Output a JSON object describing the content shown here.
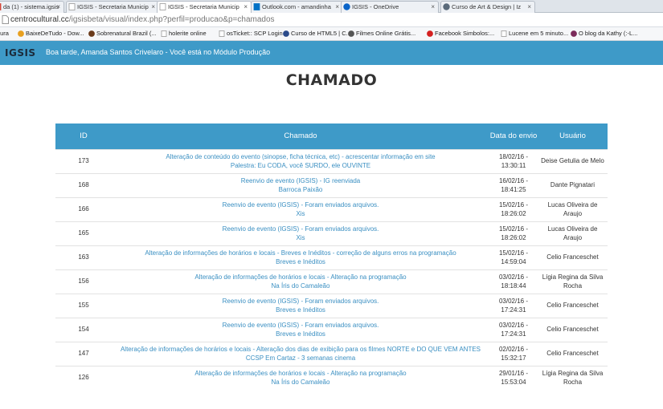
{
  "browser": {
    "tabs": [
      {
        "label": "da (1) - sistema.igsis",
        "icon": "mail-icon",
        "color": "#d44638"
      },
      {
        "label": "IGSIS - Secretaria Municip",
        "icon": "page-icon",
        "color": "#999999"
      },
      {
        "label": "IGSIS - Secretaria Municip",
        "icon": "page-icon",
        "color": "#999999",
        "active": true
      },
      {
        "label": "Outlook.com - amandinha",
        "icon": "outlook-icon",
        "color": "#0072c6"
      },
      {
        "label": "IGSIS - OneDrive",
        "icon": "onedrive-icon",
        "color": "#0a64c8"
      },
      {
        "label": "Curso de Art & Design | Iz",
        "icon": "globe-icon",
        "color": "#5a6a7a"
      }
    ],
    "url_host": "centrocultural.cc",
    "url_path": "/igsisbeta/visual/index.php?perfil=producao&p=chamados",
    "bookmarks": [
      {
        "label": "tura",
        "icon": "",
        "color": ""
      },
      {
        "label": "BaixeDeTudo - Dow...",
        "icon": "bookmark-icon",
        "color": "#e8a020"
      },
      {
        "label": "Sobrenatural Brazil (...",
        "icon": "bookmark-icon",
        "color": "#6a3a1a"
      },
      {
        "label": "holerite online",
        "icon": "page-icon",
        "color": "#999999"
      },
      {
        "label": "osTicket:: SCP Login",
        "icon": "page-icon",
        "color": "#999999"
      },
      {
        "label": "Curso de HTML5 | C...",
        "icon": "bookmark-icon",
        "color": "#2a4a8a"
      },
      {
        "label": "Filmes Online Grátis...",
        "icon": "bookmark-icon",
        "color": "#555555"
      },
      {
        "label": "Facebook Simbolos:...",
        "icon": "bookmark-icon",
        "color": "#d42020"
      },
      {
        "label": "Lucene em 5 minuto...",
        "icon": "page-icon",
        "color": "#999999"
      },
      {
        "label": "O blog da Kathy (:-L...",
        "icon": "bookmark-icon",
        "color": "#7a2a5a"
      }
    ]
  },
  "header": {
    "logo": "IGSIS",
    "greeting": "Boa tarde, Amanda Santos Crivelaro - Você está no Módulo Produção"
  },
  "page_title": "CHAMADO",
  "table": {
    "columns": [
      "ID",
      "Chamado",
      "Data do envio",
      "Usuário"
    ],
    "rows": [
      {
        "id": "173",
        "title": "Alteração de conteúdo do evento (sinopse, ficha técnica, etc) - acrescentar informação em site",
        "event": "Palestra: Eu CODA, você SURDO, ele OUVINTE",
        "date": "18/02/16 - 13:30:11",
        "user": "Deise Getulia de Melo"
      },
      {
        "id": "168",
        "title": "Reenvio de evento (IGSIS) - IG reenviada",
        "event": "Barroca Paixão",
        "date": "16/02/16 - 18:41:25",
        "user": "Dante Pignatari"
      },
      {
        "id": "166",
        "title": "Reenvio de evento (IGSIS) - Foram enviados arquivos.",
        "event": "Xis",
        "date": "15/02/16 - 18:26:02",
        "user": "Lucas Oliveira de Araujo"
      },
      {
        "id": "165",
        "title": "Reenvio de evento (IGSIS) - Foram enviados arquivos.",
        "event": "Xis",
        "date": "15/02/16 - 18:26:02",
        "user": "Lucas Oliveira de Araujo"
      },
      {
        "id": "163",
        "title": "Alteração de informações de horários e locais - Breves e Inéditos - correção de alguns erros na programação",
        "event": "Breves e Inéditos",
        "date": "15/02/16 - 14:59:04",
        "user": "Celio Franceschet"
      },
      {
        "id": "156",
        "title": "Alteração de informações de horários e locais - Alteração na programação",
        "event": "Na Íris do Camaleão",
        "date": "03/02/16 - 18:18:44",
        "user": "Lígia Regina da Silva Rocha"
      },
      {
        "id": "155",
        "title": "Reenvio de evento (IGSIS) - Foram enviados arquivos.",
        "event": "Breves e Inéditos",
        "date": "03/02/16 - 17:24:31",
        "user": "Celio Franceschet"
      },
      {
        "id": "154",
        "title": "Reenvio de evento (IGSIS) - Foram enviados arquivos.",
        "event": "Breves e Inéditos",
        "date": "03/02/16 - 17:24:31",
        "user": "Celio Franceschet"
      },
      {
        "id": "147",
        "title": "Alteração de informações de horários e locais - Alteração dos dias de exibição para os filmes NORTE e DO QUE VEM ANTES",
        "event": "CCSP Em Cartaz - 3 semanas cinema",
        "date": "02/02/16 - 15:32:17",
        "user": "Celio Franceschet"
      },
      {
        "id": "126",
        "title": "Alteração de informações de horários e locais - Alteração na programação",
        "event": "Na Íris do Camaleão",
        "date": "29/01/16 - 15:53:04",
        "user": "Lígia Regina da Silva Rocha"
      }
    ]
  },
  "colors": {
    "accent": "#3e9ac8",
    "link": "#3a8fc2"
  }
}
